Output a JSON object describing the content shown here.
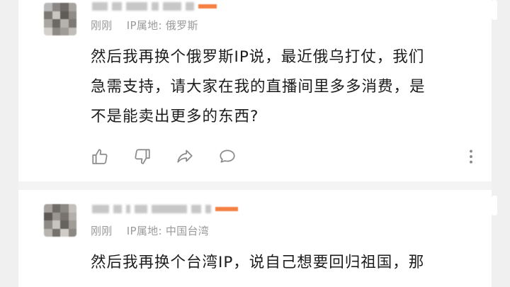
{
  "comments": [
    {
      "time": "刚刚",
      "location_label": "IP属地",
      "location": "俄罗斯",
      "text_lines": [
        "然后我再换个俄罗斯IP说，最近俄乌打仗，我们",
        "急需支持，请大家在我的直播间里多多消费，是",
        "不是能卖出更多的东西?"
      ]
    },
    {
      "time": "刚刚",
      "location_label": "IP属地",
      "location": "中国台湾",
      "text_lines": [
        "然后我再换个台湾IP，说自己想要回归祖国，那"
      ]
    }
  ],
  "actions": {
    "like_icon": "thumbs-up-icon",
    "dislike_icon": "thumbs-down-icon",
    "share_icon": "share-icon",
    "reply_icon": "comment-bubble-icon",
    "more_icon": "more-vertical-icon"
  },
  "colors": {
    "text": "#1c1c1c",
    "meta": "#9a9a9a",
    "accent": "#f47a3a",
    "icon": "#8a8a8a"
  }
}
